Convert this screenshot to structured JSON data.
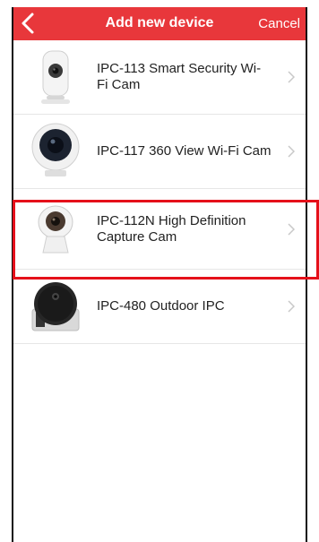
{
  "nav": {
    "title": "Add new device",
    "cancel_label": "Cancel",
    "background": "#e8373b"
  },
  "devices": [
    {
      "name": "IPC-113 Smart Security Wi-Fi Cam",
      "icon": "ipc-113-camera-image"
    },
    {
      "name": "IPC-117 360 View Wi-Fi Cam",
      "icon": "ipc-117-camera-image"
    },
    {
      "name": "IPC-112N High Definition Capture Cam",
      "icon": "ipc-112n-camera-image",
      "highlighted": true
    },
    {
      "name": "IPC-480 Outdoor IPC",
      "icon": "ipc-480-camera-image"
    }
  ],
  "highlight_color": "#e5101a"
}
